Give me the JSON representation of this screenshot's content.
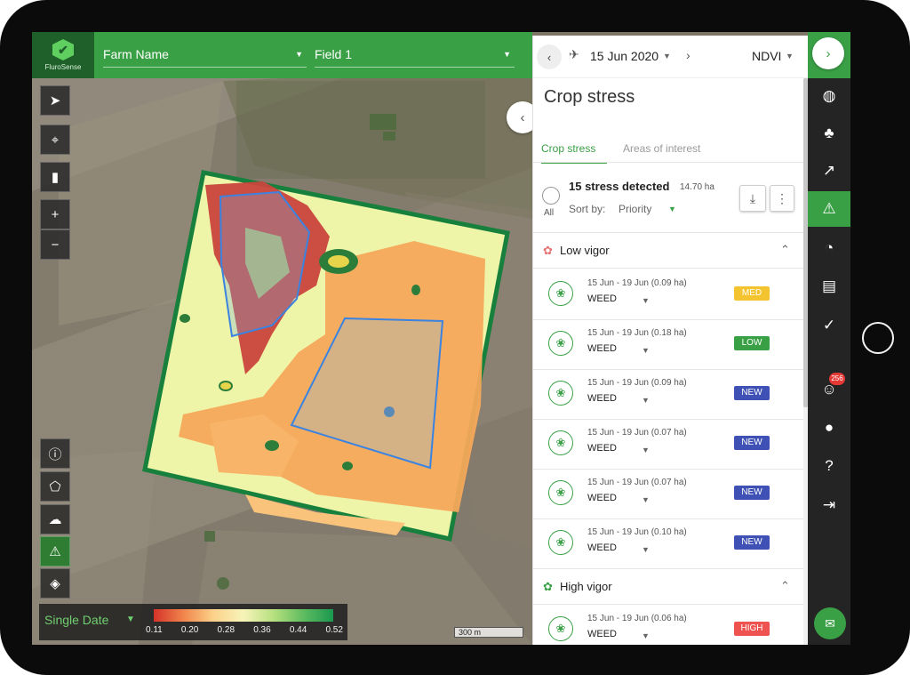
{
  "app": {
    "logo_text": "FluroSense"
  },
  "topbar": {
    "farm_label": "Farm Name",
    "field_label": "Field 1"
  },
  "legend": {
    "mode_label": "Single Date",
    "ticks": [
      "0.11",
      "0.20",
      "0.28",
      "0.36",
      "0.44",
      "0.52"
    ],
    "colors": [
      "#d53329",
      "#f1854b",
      "#fbd28a",
      "#f7f4b9",
      "#b7e07f",
      "#5fbc5f",
      "#1a9850"
    ]
  },
  "scale": {
    "label": "300 m"
  },
  "panel": {
    "date": "15 Jun 2020",
    "index": "NDVI",
    "title": "Crop stress",
    "tabs": [
      {
        "label": "Crop stress",
        "active": true
      },
      {
        "label": "Areas of interest",
        "active": false
      }
    ],
    "summary": {
      "all_label": "All",
      "count_text": "15 stress detected",
      "area_text": "14.70 ha",
      "sort_label": "Sort by:",
      "sort_value": "Priority"
    },
    "groups": [
      {
        "label": "Low vigor",
        "leaf_color": "#e57373",
        "items": [
          {
            "date": "15 Jun - 19 Jun",
            "area": "(0.09 ha)",
            "type": "WEED",
            "badge": "MED",
            "badge_color": "#f4c430"
          },
          {
            "date": "15 Jun - 19 Jun",
            "area": "(0.18 ha)",
            "type": "WEED",
            "badge": "LOW",
            "badge_color": "#3aa046"
          },
          {
            "date": "15 Jun - 19 Jun",
            "area": "(0.09 ha)",
            "type": "WEED",
            "badge": "NEW",
            "badge_color": "#3f51b5"
          },
          {
            "date": "15 Jun - 19 Jun",
            "area": "(0.07 ha)",
            "type": "WEED",
            "badge": "NEW",
            "badge_color": "#3f51b5"
          },
          {
            "date": "15 Jun - 19 Jun",
            "area": "(0.07 ha)",
            "type": "WEED",
            "badge": "NEW",
            "badge_color": "#3f51b5"
          },
          {
            "date": "15 Jun - 19 Jun",
            "area": "(0.10 ha)",
            "type": "WEED",
            "badge": "NEW",
            "badge_color": "#3f51b5"
          }
        ]
      },
      {
        "label": "High vigor",
        "leaf_color": "#3aa046",
        "items": [
          {
            "date": "15 Jun - 19 Jun",
            "area": "(0.06 ha)",
            "type": "WEED",
            "badge": "HIGH",
            "badge_color": "#ef5350"
          }
        ]
      }
    ]
  },
  "rail": {
    "notifications_count": "256",
    "items": [
      "layers-icon",
      "crop-icon",
      "analytics-icon",
      "alert-icon",
      "zones-icon",
      "gallery-icon",
      "check-icon",
      "users-icon",
      "profile-icon",
      "help-icon",
      "logout-icon"
    ]
  }
}
